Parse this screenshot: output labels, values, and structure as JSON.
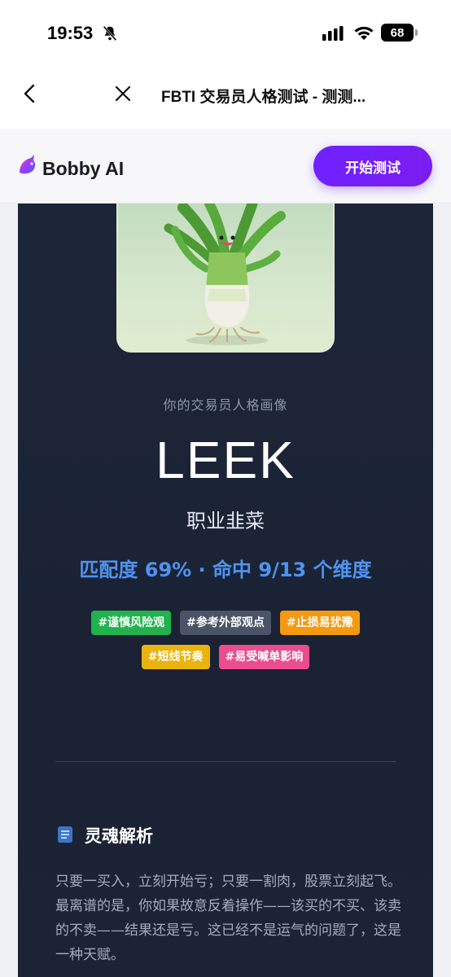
{
  "status_bar": {
    "time": "19:53",
    "battery": "68"
  },
  "nav": {
    "title": "FBTI 交易员人格测试 - 测测..."
  },
  "header": {
    "brand": "Bobby AI",
    "start_label": "开始测试"
  },
  "result": {
    "subtitle": "你的交易员人格画像",
    "type_code": "LEEK",
    "type_name": "职业韭菜",
    "match_line": "匹配度 69% · 命中 9/13 个维度",
    "tags": [
      {
        "label": "#谨慎风险观",
        "color": "#21b24d"
      },
      {
        "label": "#参考外部观点",
        "color": "#4a5466"
      },
      {
        "label": "#止损易犹豫",
        "color": "#f39a12"
      },
      {
        "label": "#短线节奏",
        "color": "#eab30e"
      },
      {
        "label": "#易受喊单影响",
        "color": "#ec4c8d"
      }
    ]
  },
  "analysis": {
    "title": "灵魂解析",
    "body": "只要一买入，立刻开始亏；只要一割肉，股票立刻起飞。最离谱的是，你如果故意反着操作——该买的不买、该卖的不卖——结果还是亏。这已经不是运气的问题了，这是一种天赋。"
  },
  "colors": {
    "accent": "#6e22ff",
    "match": "#4e93ef",
    "card": "#1d2638"
  }
}
